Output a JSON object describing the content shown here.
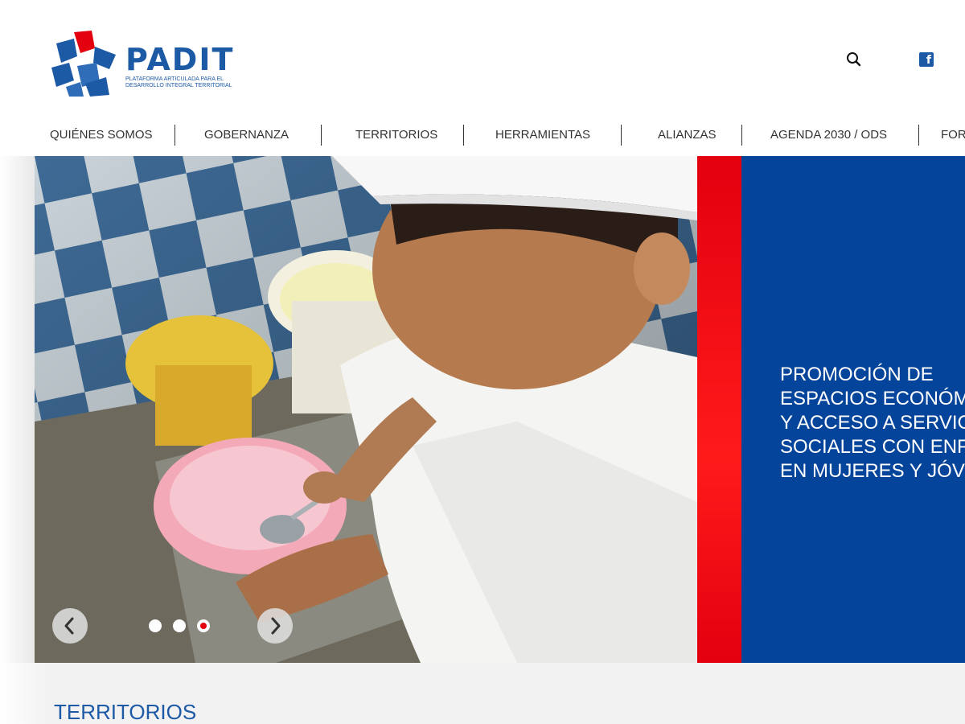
{
  "header": {
    "logo_title": "PADIT",
    "logo_subtitle": "PLATAFORMA ARTICULADA PARA EL DESARROLLO INTEGRAL TERRITORIAL",
    "search_icon": "search-icon",
    "facebook_icon": "facebook-icon",
    "facebook_glyph": "f"
  },
  "nav": {
    "items": [
      {
        "label": "QUIÉNES SOMOS"
      },
      {
        "label": "GOBERNANZA"
      },
      {
        "label": "TERRITORIOS"
      },
      {
        "label": "HERRAMIENTAS"
      },
      {
        "label": "ALIANZAS"
      },
      {
        "label": "AGENDA 2030 / ODS"
      },
      {
        "label": "FORA"
      }
    ]
  },
  "hero": {
    "caption": "PROMOCIÓN DE\nESPACIOS ECONÓM\nY ACCESO A SERVIC\nSOCIALES CON ENF\nEN MUJERES Y JÓVE",
    "prev_icon": "chevron-left-icon",
    "next_icon": "chevron-right-icon",
    "slide_count": 3,
    "active_slide": 3
  },
  "section": {
    "title": "TERRITORIOS"
  },
  "colors": {
    "brand_blue": "#1d5aa6",
    "panel_blue": "#04449a",
    "accent_red": "#e3000f",
    "section_bg": "#f2f2f2"
  }
}
